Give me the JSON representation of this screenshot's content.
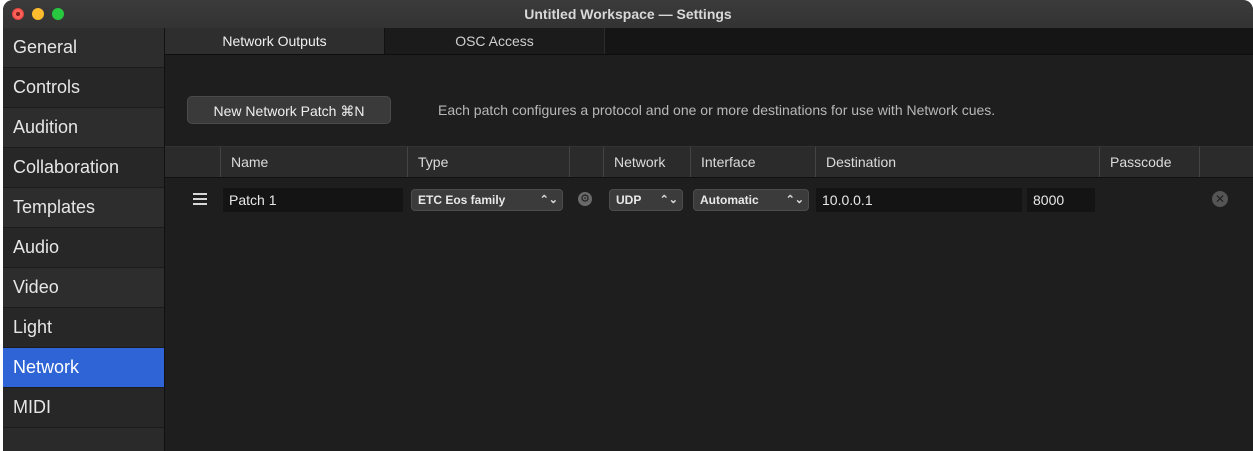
{
  "window": {
    "title": "Untitled Workspace — Settings"
  },
  "sidebar": {
    "items": [
      {
        "label": "General"
      },
      {
        "label": "Controls"
      },
      {
        "label": "Audition"
      },
      {
        "label": "Collaboration"
      },
      {
        "label": "Templates"
      },
      {
        "label": "Audio"
      },
      {
        "label": "Video"
      },
      {
        "label": "Light"
      },
      {
        "label": "Network",
        "selected": true
      },
      {
        "label": "MIDI"
      }
    ]
  },
  "tabs": [
    {
      "label": "Network Outputs",
      "active": true
    },
    {
      "label": "OSC Access",
      "active": false
    }
  ],
  "toolbar": {
    "new_patch_label": "New Network Patch ⌘N",
    "hint": "Each patch configures a protocol and one or more destinations for use with Network cues."
  },
  "table": {
    "headers": {
      "name": "Name",
      "type": "Type",
      "network": "Network",
      "interface": "Interface",
      "destination": "Destination",
      "passcode": "Passcode"
    },
    "rows": [
      {
        "name": "Patch 1",
        "type": "ETC Eos family",
        "network": "UDP",
        "interface": "Automatic",
        "destination_ip": "10.0.0.1",
        "destination_port": "8000",
        "passcode": ""
      }
    ]
  },
  "colors": {
    "accent": "#2e64d6",
    "window_bg": "#1e1e1e",
    "sidebar_bg": "#2a2a2a"
  }
}
